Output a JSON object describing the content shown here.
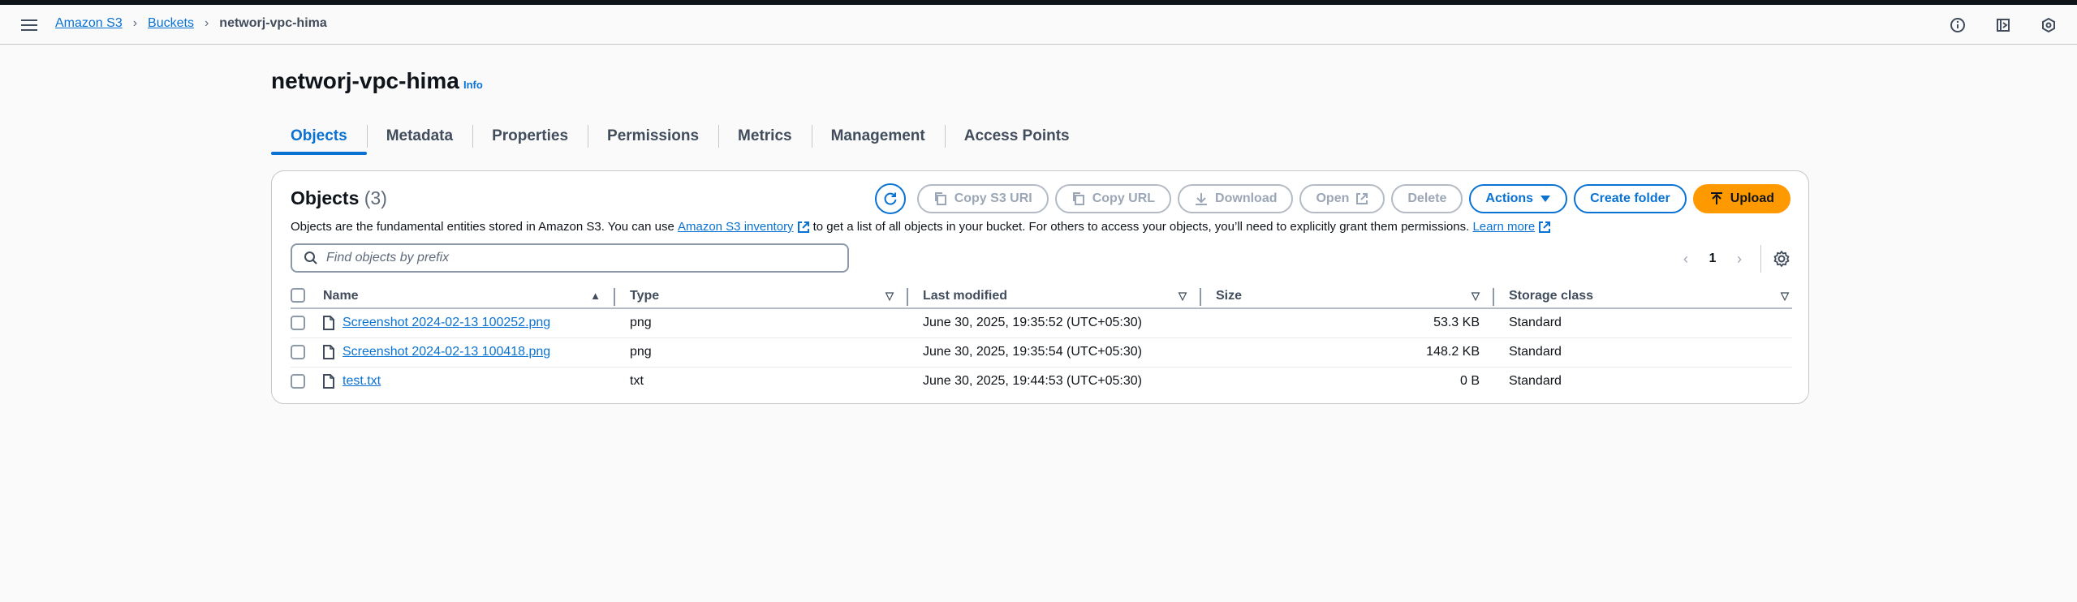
{
  "breadcrumb": {
    "items": [
      "Amazon S3",
      "Buckets"
    ],
    "current": "networj-vpc-hima"
  },
  "page": {
    "title": "networj-vpc-hima",
    "info_label": "Info"
  },
  "tabs": [
    "Objects",
    "Metadata",
    "Properties",
    "Permissions",
    "Metrics",
    "Management",
    "Access Points"
  ],
  "objects": {
    "title": "Objects",
    "count": "(3)",
    "desc_1": "Objects are the fundamental entities stored in Amazon S3. You can use",
    "desc_link_1": "Amazon S3 inventory",
    "desc_2": "to get a list of all objects in your bucket. For others to access your objects, you’ll need to explicitly grant them permissions.",
    "desc_link_2": "Learn more",
    "buttons": {
      "copy_s3_uri": "Copy S3 URI",
      "copy_url": "Copy URL",
      "download": "Download",
      "open": "Open",
      "delete": "Delete",
      "actions": "Actions",
      "create_folder": "Create folder",
      "upload": "Upload"
    },
    "search_placeholder": "Find objects by prefix",
    "page_number": "1",
    "columns": [
      "Name",
      "Type",
      "Last modified",
      "Size",
      "Storage class"
    ],
    "rows": [
      {
        "name": "Screenshot 2024-02-13 100252.png",
        "type": "png",
        "modified": "June 30, 2025, 19:35:52 (UTC+05:30)",
        "size": "53.3 KB",
        "storage": "Standard"
      },
      {
        "name": "Screenshot 2024-02-13 100418.png",
        "type": "png",
        "modified": "June 30, 2025, 19:35:54 (UTC+05:30)",
        "size": "148.2 KB",
        "storage": "Standard"
      },
      {
        "name": "test.txt",
        "type": "txt",
        "modified": "June 30, 2025, 19:44:53 (UTC+05:30)",
        "size": "0 B",
        "storage": "Standard"
      }
    ]
  },
  "colors": {
    "link": "#0972d3",
    "upload": "#ff9900",
    "text": "#0f141a"
  }
}
